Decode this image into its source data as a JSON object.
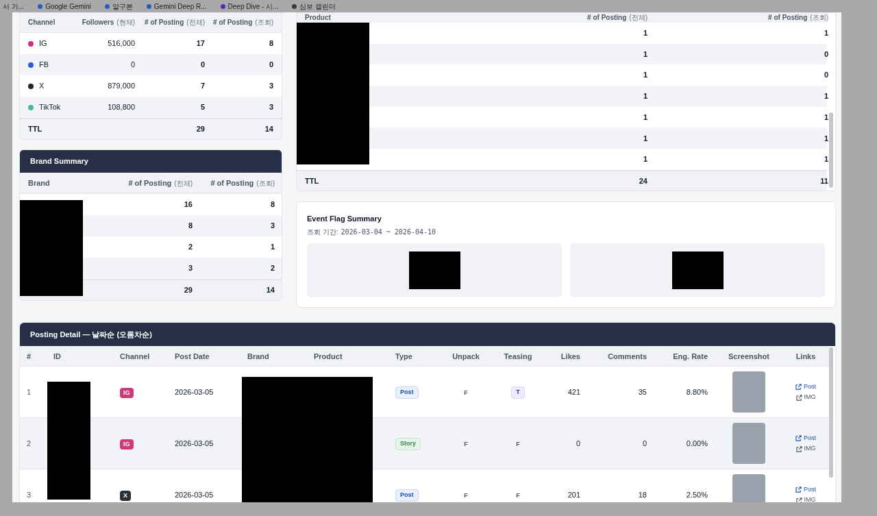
{
  "bookmarks": [
    {
      "label": "서 가..."
    },
    {
      "label": "Google Gemini",
      "color": "#2d5bb8"
    },
    {
      "label": "알구본",
      "color": "#2d5bb8"
    },
    {
      "label": "Gemini Deep R...",
      "color": "#2d5bb8"
    },
    {
      "label": "Deep Dive - 시...",
      "color": "#5a2bb0"
    },
    {
      "label": "심보 캘린더",
      "color": "#3b3b3b"
    }
  ],
  "channel_summary": {
    "columns": [
      {
        "label": "Channel"
      },
      {
        "label": "Followers",
        "note": "(현재)"
      },
      {
        "label": "# of Posting",
        "note": "(전체)"
      },
      {
        "label": "# of Posting",
        "note": "(조회)"
      }
    ],
    "rows": [
      {
        "channel": "IG",
        "color": "#c9307a",
        "followers": "516,000",
        "total": "17",
        "viewed": "8"
      },
      {
        "channel": "FB",
        "color": "#2b5fd9",
        "followers": "0",
        "total": "0",
        "viewed": "0"
      },
      {
        "channel": "X",
        "color": "#1f2530",
        "followers": "879,000",
        "total": "7",
        "viewed": "3"
      },
      {
        "channel": "TikTok",
        "color": "#4fb79a",
        "followers": "108,800",
        "total": "5",
        "viewed": "3"
      }
    ],
    "total": {
      "label": "TTL",
      "total": "29",
      "viewed": "14"
    }
  },
  "brand_summary": {
    "title": "Brand Summary",
    "columns": [
      {
        "label": "Brand"
      },
      {
        "label": "# of Posting",
        "note": "(전체)"
      },
      {
        "label": "# of Posting",
        "note": "(조회)"
      }
    ],
    "rows": [
      {
        "total": "16",
        "viewed": "8"
      },
      {
        "total": "8",
        "viewed": "3"
      },
      {
        "total": "2",
        "viewed": "1"
      },
      {
        "total": "3",
        "viewed": "2"
      }
    ],
    "total": {
      "total": "29",
      "viewed": "14"
    }
  },
  "product_summary": {
    "columns": [
      {
        "label": "Product"
      },
      {
        "label": "# of Posting",
        "note": "(전체)"
      },
      {
        "label": "# of Posting",
        "note": "(조회)"
      }
    ],
    "rows": [
      {
        "total": "1",
        "viewed": "1"
      },
      {
        "total": "1",
        "viewed": "0"
      },
      {
        "total": "1",
        "viewed": "0"
      },
      {
        "total": "1",
        "viewed": "1"
      },
      {
        "total": "1",
        "viewed": "1"
      },
      {
        "total": "1",
        "viewed": "1"
      },
      {
        "total": "1",
        "viewed": "1"
      }
    ],
    "total": {
      "label": "TTL",
      "total": "24",
      "viewed": "11"
    }
  },
  "event_flag_summary": {
    "title": "Event Flag Summary",
    "period_label": "조회 기간:",
    "period": "2026-03-04 ~ 2026-04-10"
  },
  "posting_detail": {
    "title": "Posting Detail — 날짜순 (오름차순)",
    "columns": [
      "#",
      "ID",
      "Channel",
      "Post Date",
      "Brand",
      "Product",
      "Type",
      "Unpack",
      "Teasing",
      "Likes",
      "Comments",
      "Eng. Rate",
      "Screenshot",
      "Links"
    ],
    "rows": [
      {
        "no": "1",
        "channel": {
          "label": "IG",
          "color": "#cf3a78"
        },
        "date": "2026-03-05",
        "type": {
          "label": "Post",
          "kind": "post"
        },
        "unpack": "F",
        "teasing": {
          "text": "T",
          "flagged": true
        },
        "likes": "421",
        "comments": "35",
        "eng_rate": "8.80%",
        "links": [
          "Post",
          "IMG"
        ]
      },
      {
        "no": "2",
        "channel": {
          "label": "IG",
          "color": "#cf3a78"
        },
        "date": "2026-03-05",
        "type": {
          "label": "Story",
          "kind": "story"
        },
        "unpack": "F",
        "teasing": {
          "text": "F",
          "flagged": false
        },
        "likes": "0",
        "comments": "0",
        "eng_rate": "0.00%",
        "links": [
          "Post",
          "IMG"
        ]
      },
      {
        "no": "3",
        "channel": {
          "label": "X",
          "color": "#2b3036"
        },
        "date": "2026-03-05",
        "type": {
          "label": "Post",
          "kind": "post"
        },
        "unpack": "F",
        "teasing": {
          "text": "F",
          "flagged": false
        },
        "likes": "201",
        "comments": "18",
        "eng_rate": "2.50%",
        "links": [
          "Post",
          "IMG"
        ]
      }
    ]
  }
}
